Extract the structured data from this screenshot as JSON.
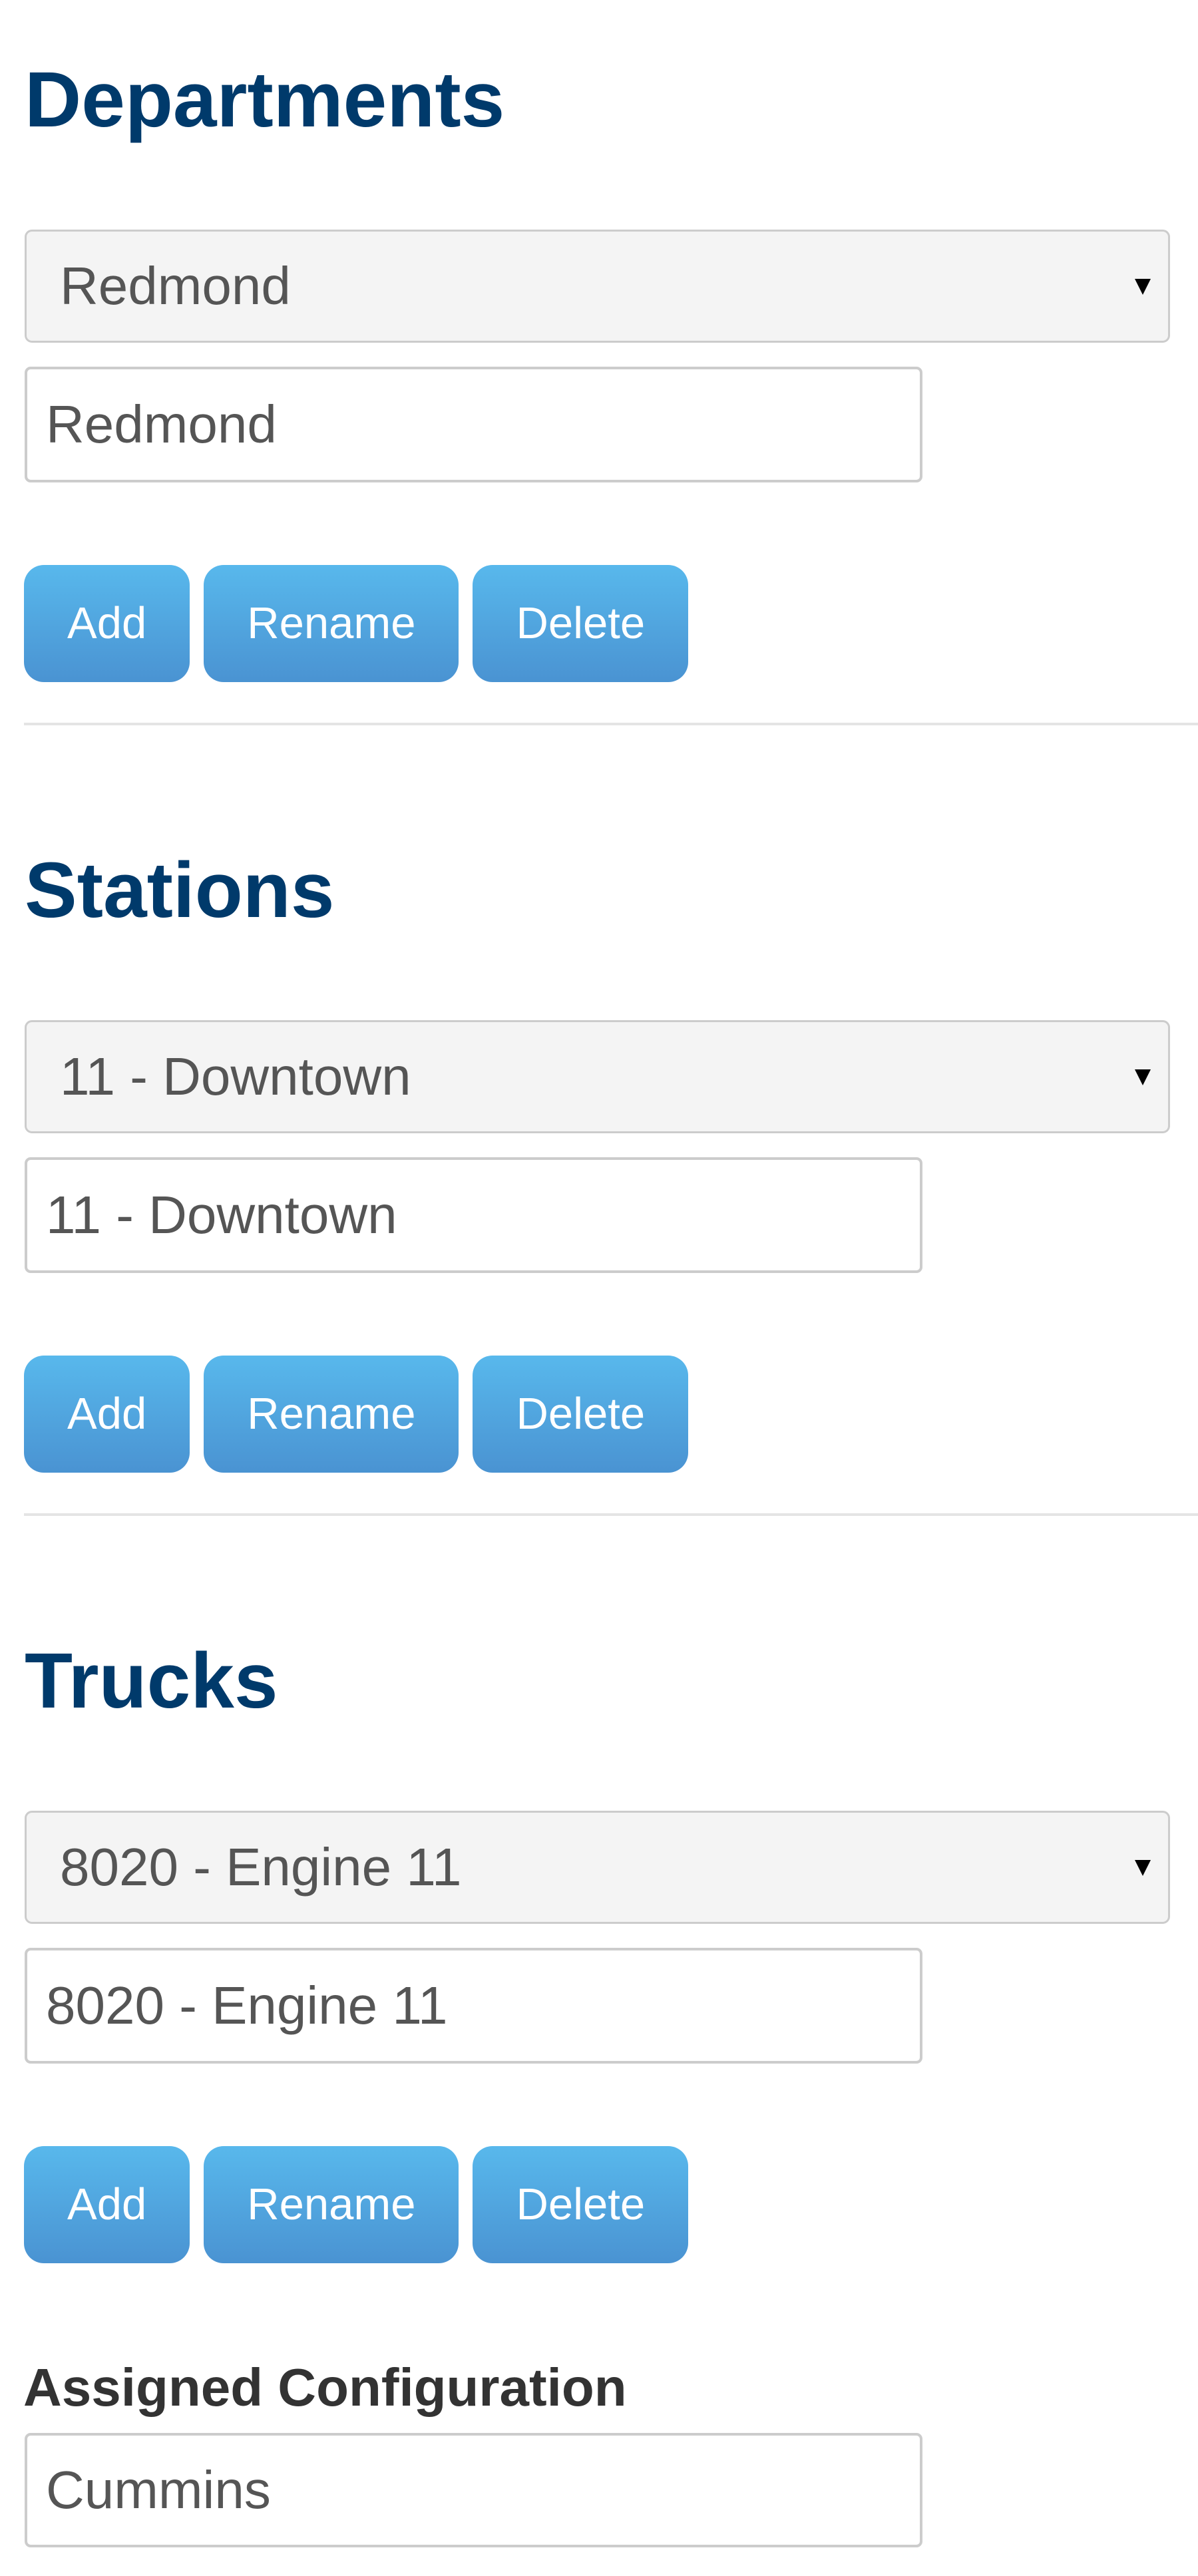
{
  "sections": [
    {
      "title": "Departments",
      "select": {
        "selected": "Redmond"
      },
      "input": {
        "value": "Redmond"
      },
      "buttons": {
        "add": "Add",
        "rename": "Rename",
        "delete": "Delete"
      }
    },
    {
      "title": "Stations",
      "select": {
        "selected": "11 - Downtown"
      },
      "input": {
        "value": "11 - Downtown"
      },
      "buttons": {
        "add": "Add",
        "rename": "Rename",
        "delete": "Delete"
      }
    },
    {
      "title": "Trucks",
      "select": {
        "selected": "8020 - Engine 11"
      },
      "input": {
        "value": "8020 - Engine 11"
      },
      "buttons": {
        "add": "Add",
        "rename": "Rename",
        "delete": "Delete"
      }
    }
  ],
  "assigned_configuration": {
    "label": "Assigned Configuration",
    "value": "Cummins"
  },
  "icons": {
    "dropdown": "chevron-down-icon"
  },
  "colors": {
    "heading": "#003a6b",
    "button_top": "#58b8ec",
    "button_bottom": "#4a93d2",
    "select_bg": "#f4f4f4",
    "border": "#cccccc",
    "input_text": "#555555",
    "label_text": "#333333"
  }
}
